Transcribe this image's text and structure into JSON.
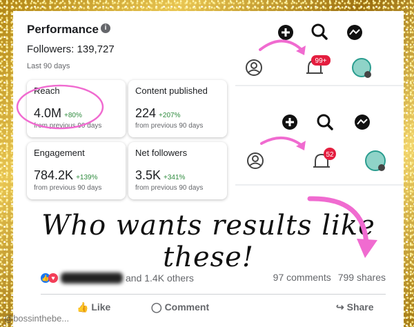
{
  "performance": {
    "title": "Performance",
    "info_icon": "ⓘ",
    "followers": "Followers: 139,727",
    "period": "Last 90 days",
    "metrics": [
      {
        "label": "Reach",
        "value": "4.0M",
        "change": "+80%",
        "sub": "from previous 90 days"
      },
      {
        "label": "Content published",
        "value": "224",
        "change": "+207%",
        "sub": "from previous 90 days"
      },
      {
        "label": "Engagement",
        "value": "784.2K",
        "change": "+139%",
        "sub": "from previous 90 days"
      },
      {
        "label": "Net followers",
        "value": "3.5K",
        "change": "+341%",
        "sub": "from previous 90 days"
      }
    ]
  },
  "notifications": {
    "top_badge": "99+",
    "bottom_badge": "52"
  },
  "headline": "Who wants results like these!",
  "post": {
    "reactions_text": "and 1.4K others",
    "comments": "97 comments",
    "shares": "799 shares",
    "like": "Like",
    "comment": "Comment",
    "share": "Share"
  },
  "watermark": "@bossinthebe..."
}
